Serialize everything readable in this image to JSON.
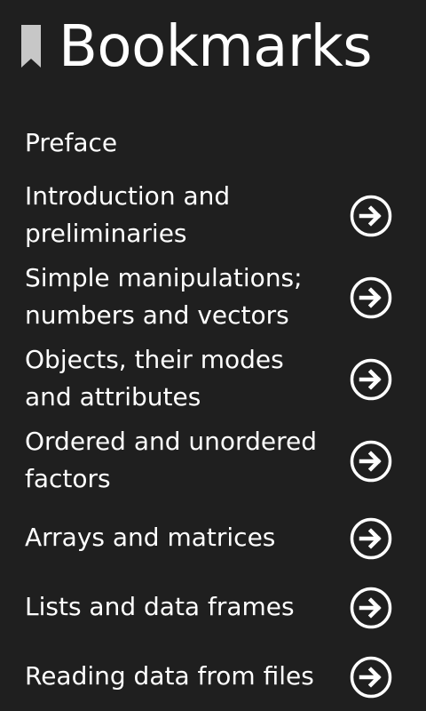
{
  "header": {
    "title": "Bookmarks",
    "icon": "bookmark-icon"
  },
  "items": [
    {
      "lines": [
        "Preface"
      ],
      "has_arrow": false
    },
    {
      "lines": [
        "Introduction and",
        "preliminaries"
      ],
      "has_arrow": true
    },
    {
      "lines": [
        "Simple manipulations;",
        "numbers and vectors"
      ],
      "has_arrow": true
    },
    {
      "lines": [
        "Objects, their modes",
        "and attributes"
      ],
      "has_arrow": true
    },
    {
      "lines": [
        "Ordered and unordered",
        "factors"
      ],
      "has_arrow": true
    },
    {
      "lines": [
        "Arrays and matrices"
      ],
      "has_arrow": true
    },
    {
      "lines": [
        "Lists and data frames"
      ],
      "has_arrow": true
    },
    {
      "lines": [
        "Reading data from files"
      ],
      "has_arrow": true
    }
  ],
  "arrow_icon": "arrow-right-circle-icon",
  "colors": {
    "background": "#1f1f1f",
    "text": "#ffffff",
    "bookmark": "#c7c7c7"
  }
}
